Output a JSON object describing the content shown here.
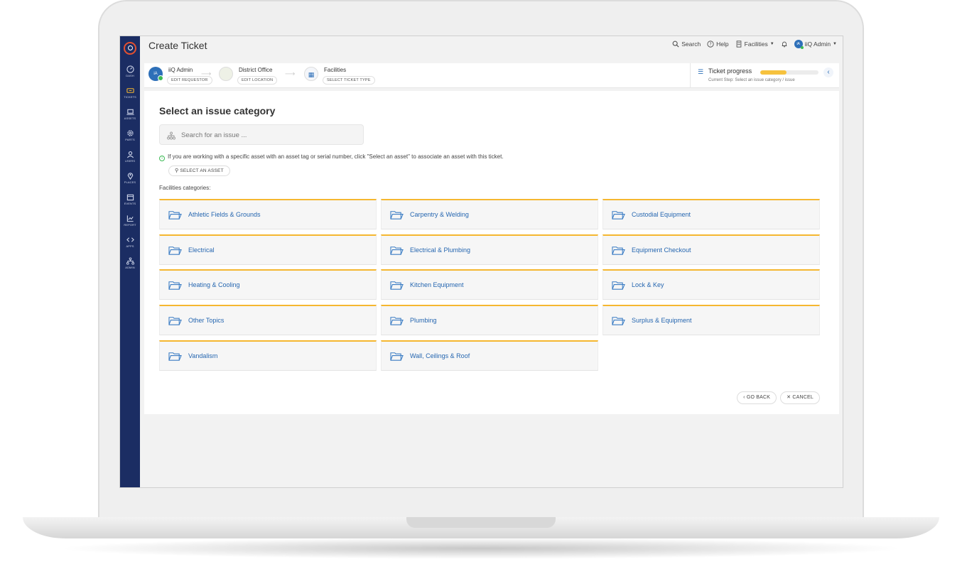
{
  "app": {
    "title": "Create Ticket"
  },
  "sidebar": {
    "items": [
      {
        "label": "DASH",
        "icon": "gauge-icon"
      },
      {
        "label": "TICKETS",
        "icon": "ticket-icon"
      },
      {
        "label": "ASSETS",
        "icon": "laptop-icon"
      },
      {
        "label": "PARTS",
        "icon": "gear-icon"
      },
      {
        "label": "USERS",
        "icon": "user-icon"
      },
      {
        "label": "PLACES",
        "icon": "map-pin-icon"
      },
      {
        "label": "EVENTS",
        "icon": "calendar-icon"
      },
      {
        "label": "REPORT",
        "icon": "chart-icon"
      },
      {
        "label": "APPS",
        "icon": "code-icon"
      },
      {
        "label": "ADMIN",
        "icon": "sitemap-icon"
      }
    ]
  },
  "topbar": {
    "search_label": "Search",
    "help_label": "Help",
    "facilities_label": "Facilities",
    "user_label": "iiQ Admin",
    "user_initials": "iA"
  },
  "steps": {
    "requestor": {
      "title": "iiQ Admin",
      "button": "EDIT REQUESTOR",
      "initials": "iA"
    },
    "location": {
      "title": "District Office",
      "button": "EDIT LOCATION"
    },
    "type": {
      "title": "Facilities",
      "button": "SELECT TICKET TYPE"
    }
  },
  "ticket_progress": {
    "title": "Ticket progress",
    "current_step": "Current Step: Select an issue category / issue",
    "percent": 0.45,
    "accent": "#f6c23e"
  },
  "main": {
    "section_title": "Select an issue category",
    "search_placeholder": "Search for an issue ...",
    "info_text": "If you are working with a specific asset with an asset tag or serial number, click \"Select an asset\" to associate an asset with this ticket.",
    "select_asset_label": "SELECT AN ASSET",
    "categories_label": "Facilities categories:",
    "categories": [
      "Athletic Fields & Grounds",
      "Carpentry & Welding",
      "Custodial Equipment",
      "Electrical",
      "Electrical & Plumbing",
      "Equipment Checkout",
      "Heating & Cooling",
      "Kitchen Equipment",
      "Lock & Key",
      "Other Topics",
      "Plumbing",
      "Surplus & Equipment",
      "Vandalism",
      "Wall, Ceilings & Roof"
    ],
    "go_back_label": "GO BACK",
    "cancel_label": "CANCEL"
  },
  "colors": {
    "sidebar": "#1b2d63",
    "card_accent": "#f5b730",
    "link": "#2566b0",
    "brand_red": "#e4502f"
  }
}
